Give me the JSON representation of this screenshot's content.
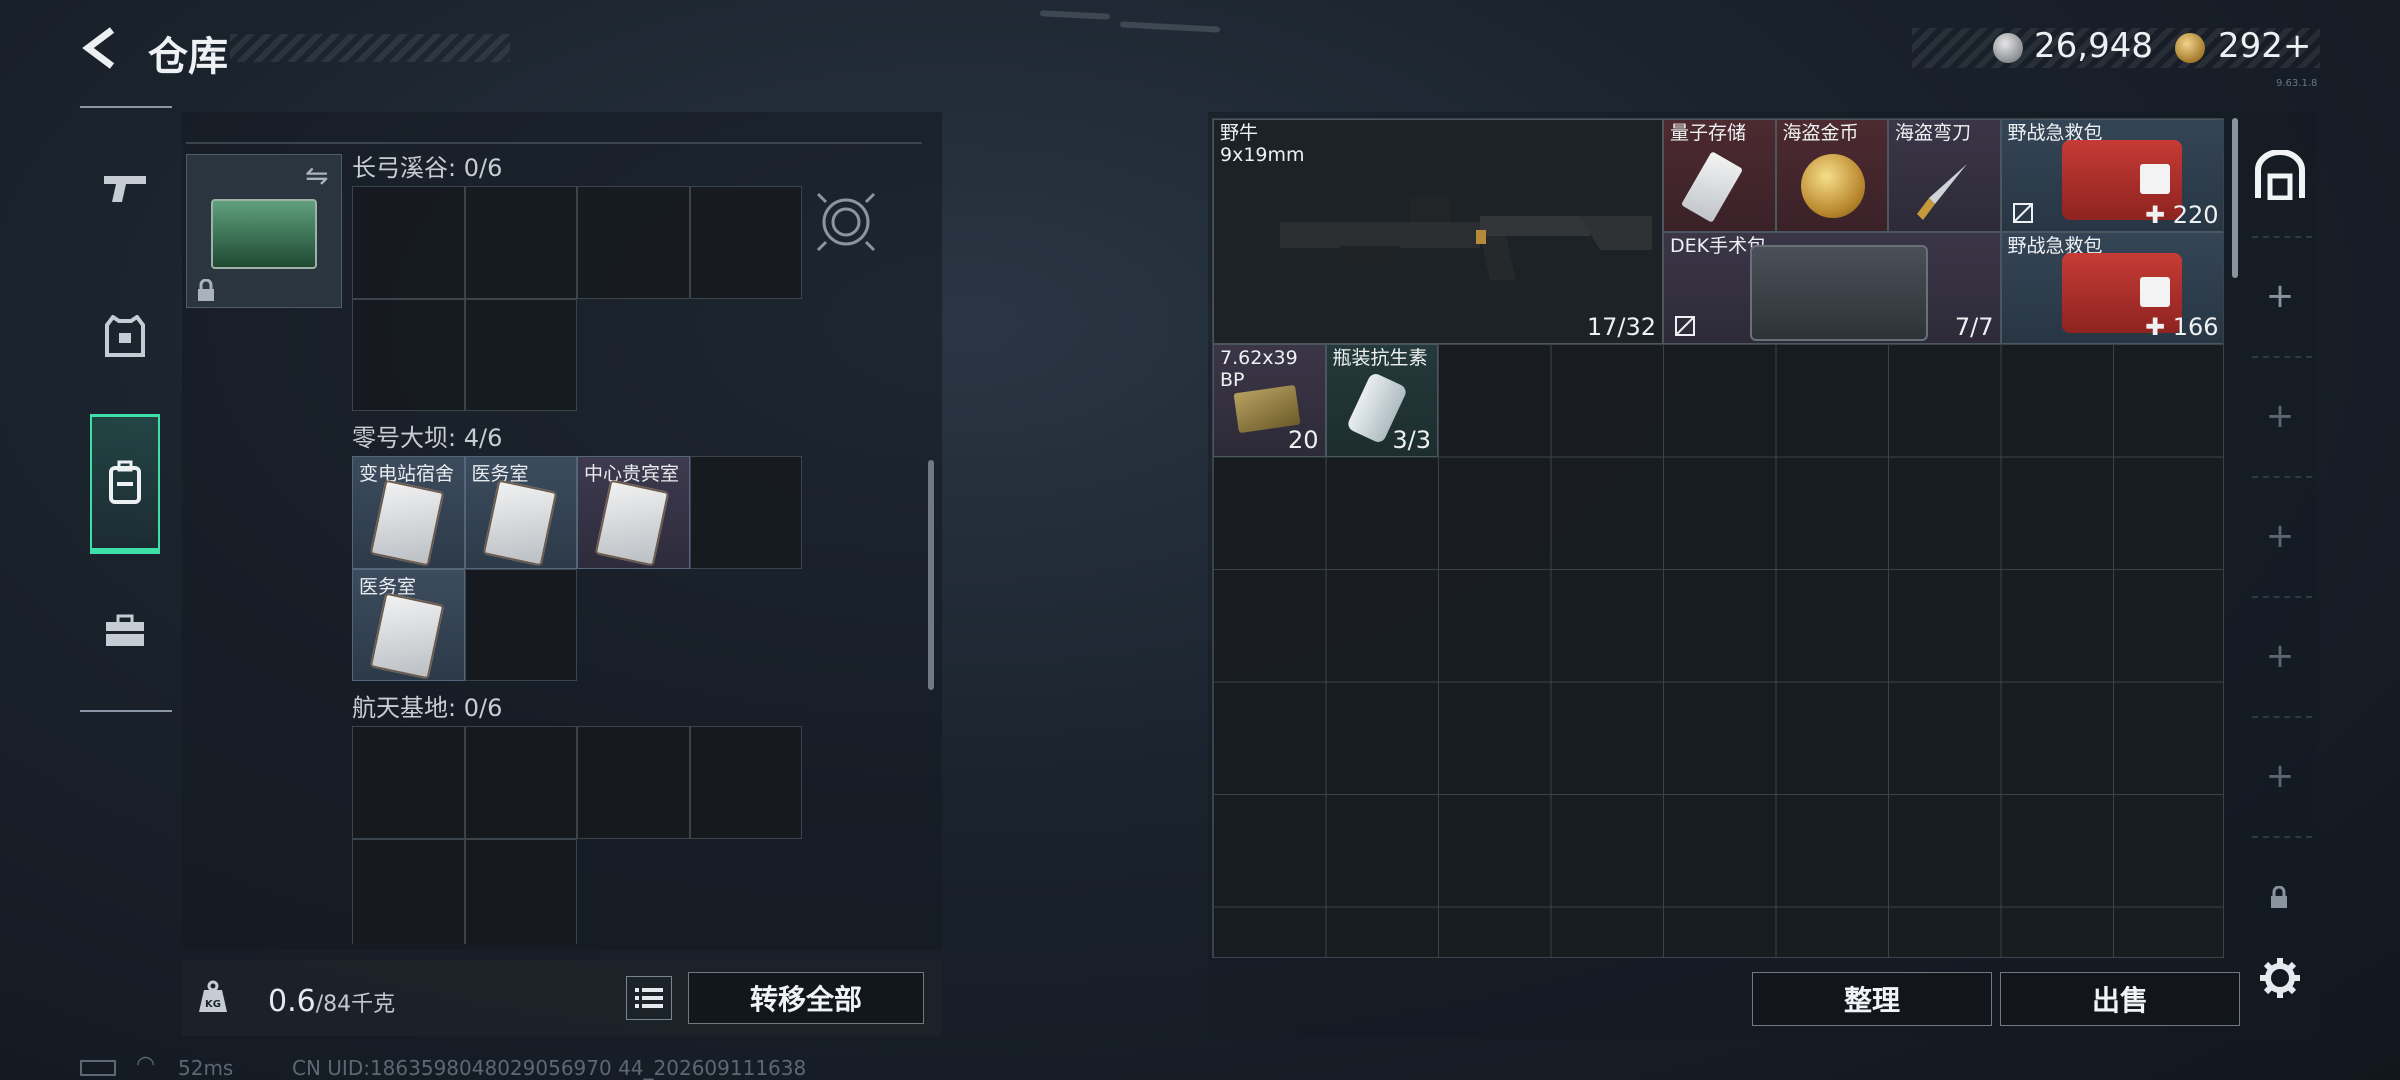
{
  "header": {
    "title": "仓库",
    "currency_silver": "26,948",
    "currency_gold": "292+",
    "version": "9.63.1.8"
  },
  "nav": {
    "items": [
      {
        "icon": "gun-icon"
      },
      {
        "icon": "armor-vest-icon"
      },
      {
        "icon": "backpack-icon",
        "active": true
      },
      {
        "icon": "toolbox-icon"
      }
    ]
  },
  "left": {
    "keycard_bag": {
      "icon": "keycard-case-icon"
    },
    "sections": [
      {
        "label": "长弓溪谷: 0/6"
      },
      {
        "label": "零号大坝: 4/6",
        "cards": [
          "变电站宿舍",
          "医务室",
          "中心贵宾室",
          "医务室"
        ]
      },
      {
        "label": "航天基地: 0/6"
      }
    ],
    "weight": "0.6",
    "weight_cap": "/84千克",
    "transfer_all": "转移全部"
  },
  "right": {
    "items": {
      "rifle": {
        "name": "野牛",
        "caliber": "9x19mm",
        "qty": "17/32"
      },
      "quantum": {
        "name": "量子存储"
      },
      "coin": {
        "name": "海盗金币"
      },
      "knife": {
        "name": "海盗弯刀"
      },
      "medkit1": {
        "name": "野战急救包",
        "qty": "220"
      },
      "dek": {
        "name": "DEK手术包",
        "qty": "7/7"
      },
      "medkit2": {
        "name": "野战急救包",
        "qty": "166"
      },
      "ammo": {
        "name": "7.62x39",
        "name2": "BP",
        "qty": "20"
      },
      "antibiotic": {
        "name": "瓶装抗生素",
        "qty": "3/3"
      }
    },
    "tidy": "整理",
    "sell": "出售"
  },
  "status": {
    "ping": "52ms",
    "uid": "CN UID:1863598048029056970 44_202609111638"
  },
  "colors": {
    "accent": "#3ee0a8",
    "rare_red": "#4c2a30",
    "rare_purple": "#3b3647",
    "rare_blue": "#344556"
  }
}
